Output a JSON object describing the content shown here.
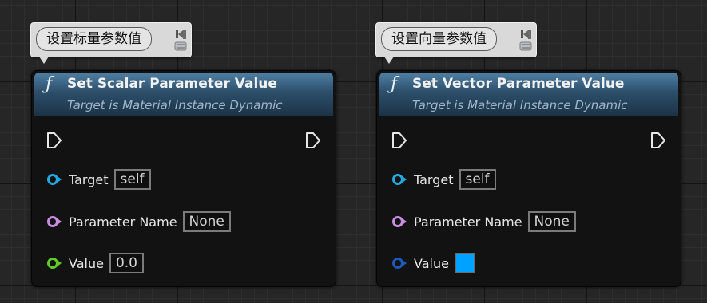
{
  "nodes": [
    {
      "comment": "设置标量参数值",
      "title": "Set Scalar Parameter Value",
      "subtitle": "Target is Material Instance Dynamic",
      "func_icon": "ƒ",
      "pins": {
        "target": {
          "label": "Target",
          "value": "self"
        },
        "parameter_name": {
          "label": "Parameter Name",
          "value": "None"
        },
        "value": {
          "label": "Value",
          "value": "0.0"
        }
      }
    },
    {
      "comment": "设置向量参数值",
      "title": "Set Vector Parameter Value",
      "subtitle": "Target is Material Instance Dynamic",
      "func_icon": "ƒ",
      "pins": {
        "target": {
          "label": "Target",
          "value": "self"
        },
        "parameter_name": {
          "label": "Parameter Name",
          "value": "None"
        },
        "value": {
          "label": "Value",
          "color": "#00A2FF"
        }
      }
    }
  ],
  "colors": {
    "object_pin": "#21a9e0",
    "name_pin": "#c88ce0",
    "float_pin": "#5fcc2a",
    "linear_color_pin": "#1d5ab8"
  },
  "icons": {
    "exec": "exec-pin-icon",
    "comment_pin": "comment-pin-icon",
    "function": "function-icon"
  }
}
